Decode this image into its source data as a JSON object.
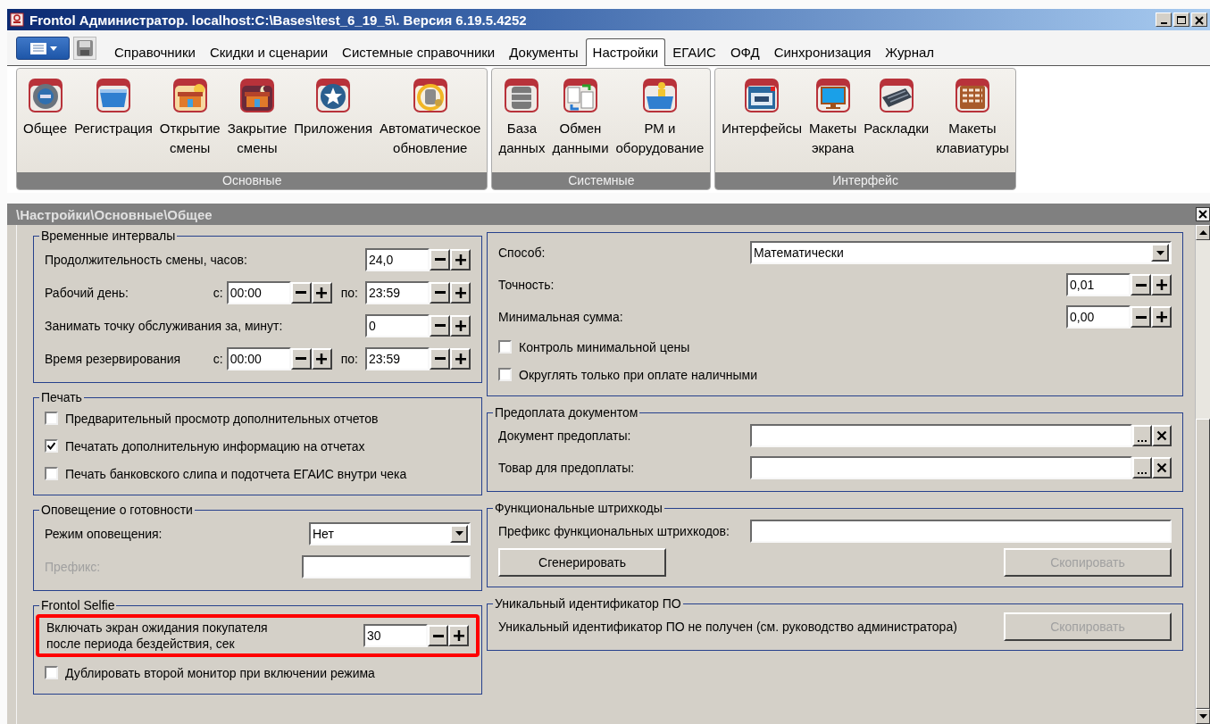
{
  "window": {
    "title": "Frontol Администратор. localhost:C:\\Bases\\test_6_19_5\\. Версия 6.19.5.4252"
  },
  "menu_tabs": [
    {
      "label": "Справочники",
      "selected": false
    },
    {
      "label": "Скидки и сценарии",
      "selected": false
    },
    {
      "label": "Системные справочники",
      "selected": false
    },
    {
      "label": "Документы",
      "selected": false
    },
    {
      "label": "Настройки",
      "selected": true
    },
    {
      "label": "ЕГАИС",
      "selected": false
    },
    {
      "label": "ОФД",
      "selected": false
    },
    {
      "label": "Синхронизация",
      "selected": false
    },
    {
      "label": "Журнал",
      "selected": false
    }
  ],
  "ribbon_groups": [
    {
      "title": "Основные",
      "items": [
        {
          "label": "Общее"
        },
        {
          "label": "Регистрация"
        },
        {
          "label": "Открытие\nсмены"
        },
        {
          "label": "Закрытие\nсмены"
        },
        {
          "label": "Приложения"
        },
        {
          "label": "Автоматическое\nобновление"
        }
      ]
    },
    {
      "title": "Системные",
      "items": [
        {
          "label": "База\nданных"
        },
        {
          "label": "Обмен\nданными"
        },
        {
          "label": "РМ и\nоборудование"
        }
      ]
    },
    {
      "title": "Интерфейс",
      "items": [
        {
          "label": "Интерфейсы"
        },
        {
          "label": "Макеты\nэкрана"
        },
        {
          "label": "Раскладки"
        },
        {
          "label": "Макеты\nклавиатуры"
        }
      ]
    }
  ],
  "path": "\\Настройки\\Основные\\Общее",
  "left_groups": [
    {
      "title": "Временные интервалы",
      "rows": [
        {
          "kind": "spin",
          "label": "Продолжительность смены, часов:",
          "value": "24,0"
        },
        {
          "kind": "range",
          "label": "Рабочий день:",
          "from_label": "с:",
          "from": "00:00",
          "to_label": "по:",
          "to": "23:59"
        },
        {
          "kind": "spin",
          "label": "Занимать точку обслуживания за, минут:",
          "value": "0"
        },
        {
          "kind": "range",
          "label": "Время резервирования",
          "from_label": "с:",
          "from": "00:00",
          "to_label": "по:",
          "to": "23:59"
        }
      ]
    },
    {
      "title": "Печать",
      "rows": [
        {
          "kind": "checkbox",
          "label": "Предварительный просмотр дополнительных отчетов",
          "checked": false
        },
        {
          "kind": "checkbox",
          "label": "Печатать дополнительную информацию на отчетах",
          "checked": true
        },
        {
          "kind": "checkbox",
          "label": "Печать банковского слипа и подотчета ЕГАИС внутри чека",
          "checked": false
        }
      ]
    },
    {
      "title": "Оповещение о готовности",
      "rows": [
        {
          "kind": "combo",
          "label": "Режим оповещения:",
          "value": "Нет"
        },
        {
          "kind": "text",
          "label": "Префикс:",
          "disabled": true
        }
      ]
    },
    {
      "title": "Frontol Selfie",
      "rows": [
        {
          "kind": "spin",
          "label": "Включать экран ожидания покупателя\nпосле периода бездействия, сек",
          "value": "30",
          "highlighted": true
        },
        {
          "kind": "checkbox",
          "label": "Дублировать второй монитор при включении  режима",
          "checked": false
        }
      ]
    }
  ],
  "right_groups": [
    {
      "rows": [
        {
          "kind": "combo",
          "label": "Способ:",
          "value": "Математически"
        },
        {
          "kind": "spin",
          "label": "Точность:",
          "value": "0,01"
        },
        {
          "kind": "spin",
          "label": "Минимальная сумма:",
          "value": "0,00"
        },
        {
          "kind": "checkbox",
          "label": "Контроль минимальной цены",
          "checked": false
        },
        {
          "kind": "checkbox",
          "label": "Округлять только при оплате наличными",
          "checked": false
        }
      ]
    },
    {
      "title": "Предоплата документом",
      "rows": [
        {
          "kind": "lookup",
          "label": "Документ предоплаты:"
        },
        {
          "kind": "lookup",
          "label": "Товар для предоплаты:"
        }
      ]
    },
    {
      "title": "Функциональные штрихкоды",
      "rows": [
        {
          "kind": "text",
          "label": "Префикс функциональных штрихкодов:",
          "disabled": false
        },
        {
          "kind": "buttons",
          "buttons": [
            {
              "label": "Сгенерировать",
              "disabled": false
            },
            {
              "label": "Скопировать",
              "disabled": true
            }
          ]
        }
      ]
    },
    {
      "title": "Уникальный идентификатор ПО",
      "rows": [
        {
          "kind": "note",
          "label": "Уникальный идентификатор ПО не получен (см. руководство администратора)",
          "button": {
            "label": "Скопировать",
            "disabled": true
          }
        }
      ]
    }
  ]
}
